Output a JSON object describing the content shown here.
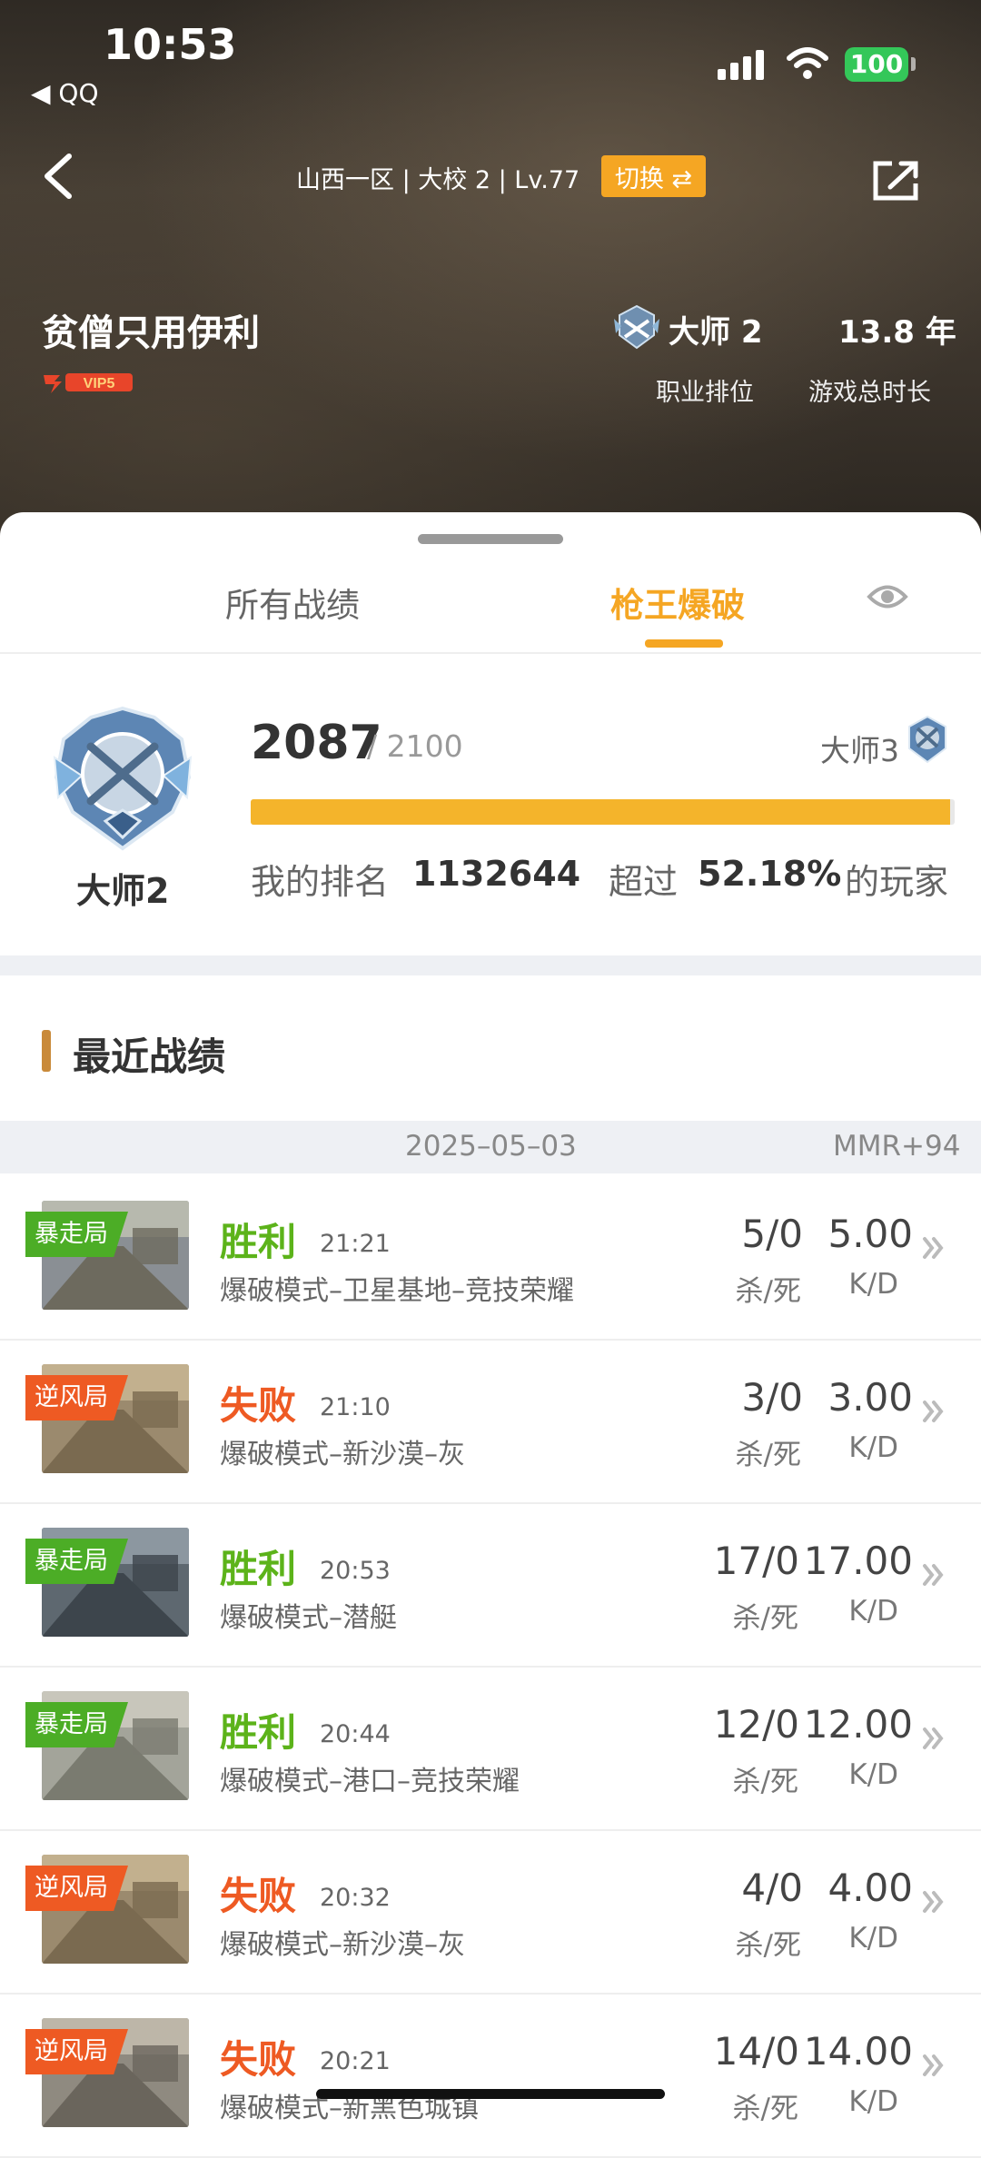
{
  "status_bar": {
    "time": "10:53",
    "back_app": "◀ QQ",
    "battery": "100"
  },
  "header": {
    "server_info": "山西一区 | 大校 2 | Lv.77",
    "switch_label": "切换 ⇄",
    "player_name": "贫僧只用伊利",
    "vip_label": "VIP5",
    "rank_value": "大师 2",
    "rank_caption": "职业排位",
    "play_time_value": "13.8 年",
    "play_time_caption": "游戏总时长"
  },
  "tabs": {
    "all_label": "所有战绩",
    "active_label": "枪王爆破"
  },
  "rank_panel": {
    "emblem_label": "大师2",
    "score": "2087",
    "score_total": "/ 2100",
    "progress_fraction": 0.994,
    "next_rank": "大师3",
    "my_rank_label": "我的排名",
    "my_rank_value": "1132644",
    "exceed_label": "超过",
    "exceed_value": "52.18%",
    "players_label": "的玩家"
  },
  "recent": {
    "title": "最近战绩",
    "date": "2025–05–03",
    "mmr": "MMR+94",
    "matches": [
      {
        "tag": "暴走局",
        "tag_color": "green",
        "result": "胜利",
        "result_type": "win",
        "time": "21:21",
        "mode": "爆破模式–卫星基地–竞技荣耀",
        "kills": "5/0",
        "kd": "5.00",
        "kills_caption": "杀/死",
        "kd_caption": "K/D"
      },
      {
        "tag": "逆风局",
        "tag_color": "orange",
        "result": "失败",
        "result_type": "loss",
        "time": "21:10",
        "mode": "爆破模式–新沙漠–灰",
        "kills": "3/0",
        "kd": "3.00",
        "kills_caption": "杀/死",
        "kd_caption": "K/D"
      },
      {
        "tag": "暴走局",
        "tag_color": "green",
        "result": "胜利",
        "result_type": "win",
        "time": "20:53",
        "mode": "爆破模式–潜艇",
        "kills": "17/0",
        "kd": "17.00",
        "kills_caption": "杀/死",
        "kd_caption": "K/D"
      },
      {
        "tag": "暴走局",
        "tag_color": "green",
        "result": "胜利",
        "result_type": "win",
        "time": "20:44",
        "mode": "爆破模式–港口–竞技荣耀",
        "kills": "12/0",
        "kd": "12.00",
        "kills_caption": "杀/死",
        "kd_caption": "K/D"
      },
      {
        "tag": "逆风局",
        "tag_color": "orange",
        "result": "失败",
        "result_type": "loss",
        "time": "20:32",
        "mode": "爆破模式–新沙漠–灰",
        "kills": "4/0",
        "kd": "4.00",
        "kills_caption": "杀/死",
        "kd_caption": "K/D"
      },
      {
        "tag": "逆风局",
        "tag_color": "orange",
        "result": "失败",
        "result_type": "loss",
        "time": "20:21",
        "mode": "爆破模式–新黑色城镇",
        "kills": "14/0",
        "kd": "14.00",
        "kills_caption": "杀/死",
        "kd_caption": "K/D"
      }
    ]
  }
}
